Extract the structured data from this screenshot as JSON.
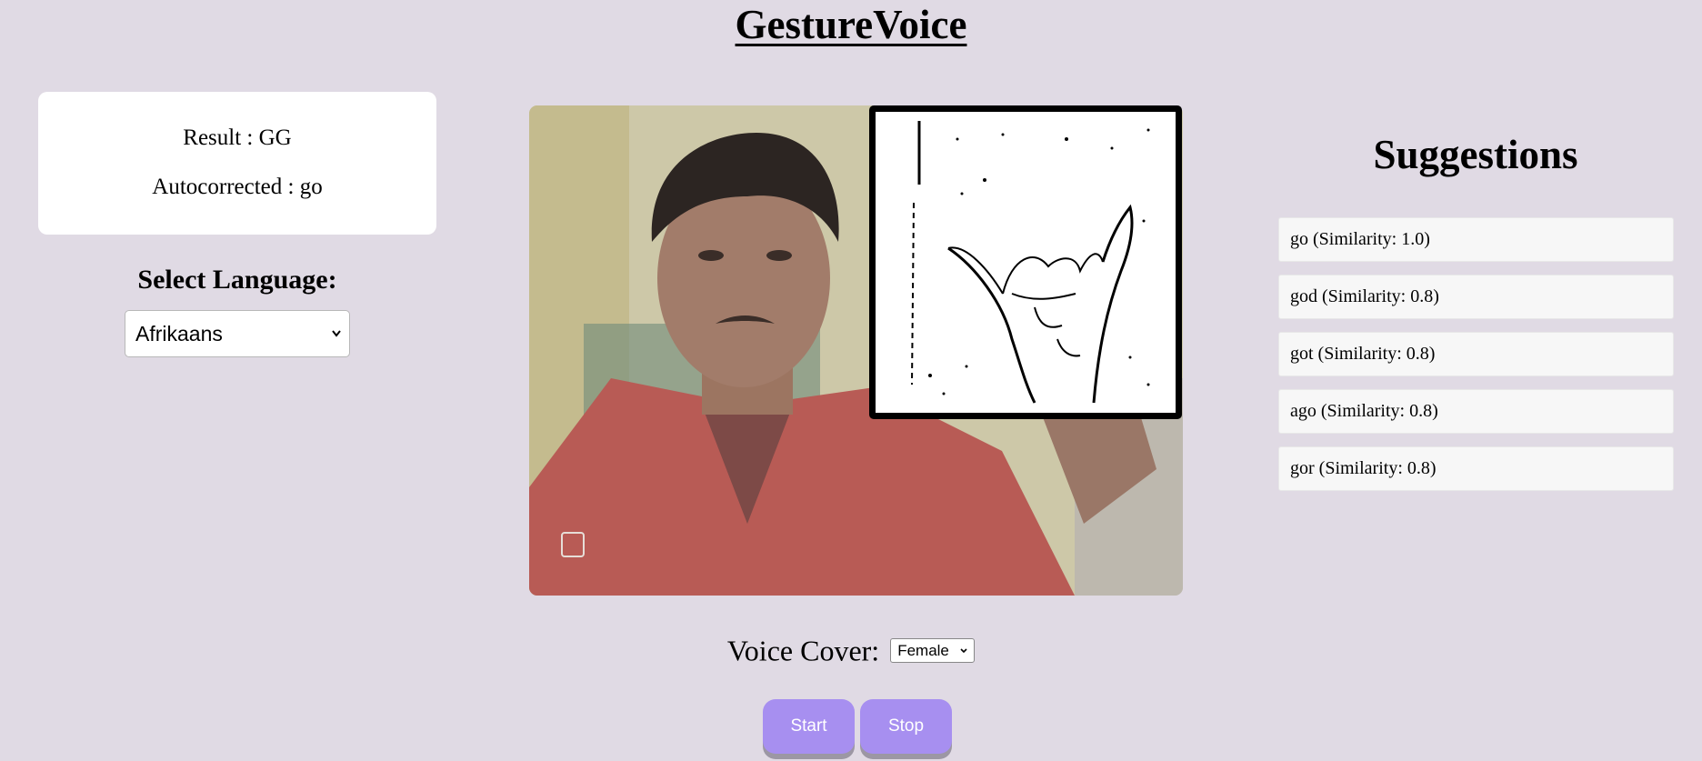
{
  "app": {
    "title": "GestureVoice"
  },
  "result": {
    "result_text": "Result : GG",
    "autocorrected_text": "Autocorrected : go"
  },
  "language": {
    "heading": "Select Language:",
    "selected": "Afrikaans"
  },
  "suggestions": {
    "heading": "Suggestions",
    "items": [
      "go (Similarity: 1.0)",
      "god (Similarity: 0.8)",
      "got (Similarity: 0.8)",
      "ago (Similarity: 0.8)",
      "gor (Similarity: 0.8)"
    ]
  },
  "voice": {
    "label": "Voice Cover:",
    "selected": "Female"
  },
  "controls": {
    "start_label": "Start",
    "stop_label": "Stop"
  },
  "colors": {
    "page_background": "#e0dae4",
    "button": "#a78ff0",
    "card": "#ffffff",
    "suggestion_item": "#f7f7f7"
  }
}
